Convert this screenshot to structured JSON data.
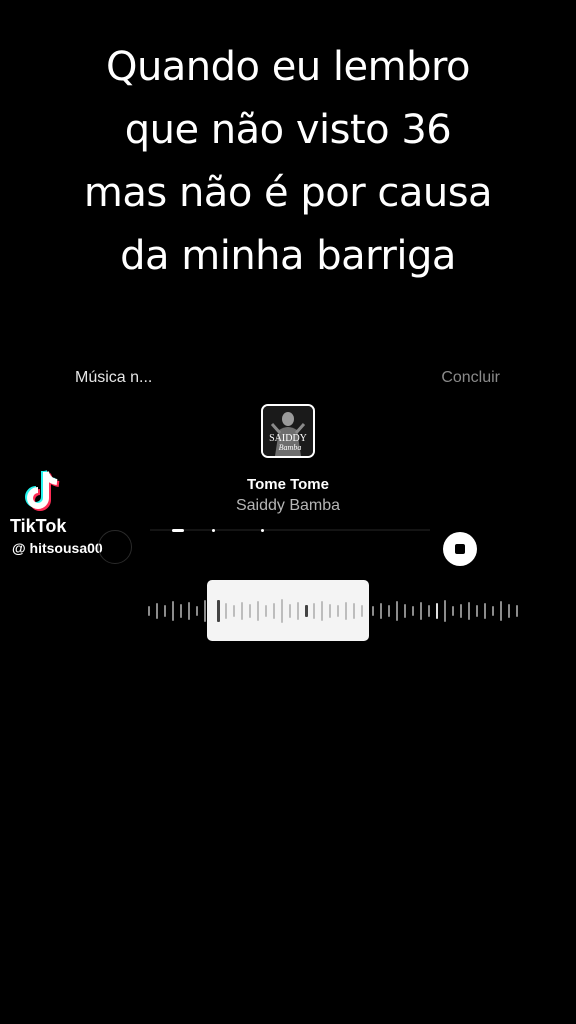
{
  "caption": {
    "lines": [
      "Quando eu lembro",
      "que não visto 36",
      "mas não é por causa",
      "da minha barriga"
    ]
  },
  "music_picker": {
    "label": "Música n...",
    "done_label": "Concluir"
  },
  "track": {
    "title": "Tome Tome",
    "artist": "Saiddy Bamba",
    "album_art_text": [
      "SAIDDY",
      "Bamba"
    ]
  },
  "watermark": {
    "brand": "TikTok",
    "username": "@ hitsousa00"
  },
  "icons": {
    "tiktok": "tiktok-logo-icon",
    "stop": "stop-icon"
  },
  "colors": {
    "background": "#000000",
    "text": "#ffffff",
    "muted": "#8a8a8a",
    "tiktok_cyan": "#25f4ee",
    "tiktok_red": "#fe2c55"
  }
}
